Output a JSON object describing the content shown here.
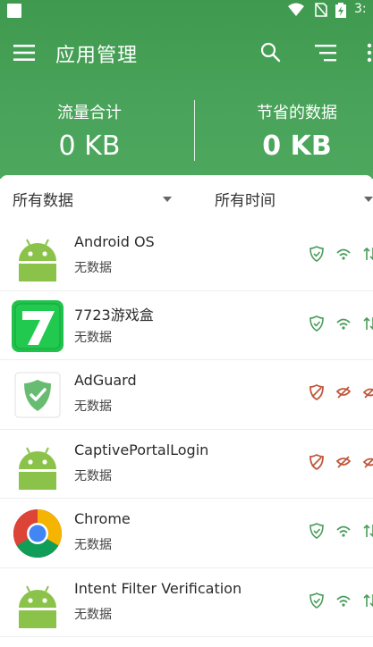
{
  "status_bar": {
    "time": "3:"
  },
  "toolbar": {
    "title": "应用管理"
  },
  "summary": {
    "total_label": "流量合计",
    "total_value": "0 KB",
    "saved_label": "节省的数据",
    "saved_value": "0 KB"
  },
  "filters": {
    "data_filter": "所有数据",
    "time_filter": "所有时间"
  },
  "colors": {
    "header_green": "#46a057",
    "allowed_green": "#4a9d5a",
    "blocked_red": "#c0563a"
  },
  "apps": [
    {
      "name": "Android OS",
      "status": "无数据",
      "icon": "android-icon",
      "state": "allowed"
    },
    {
      "name": "7723游戏盒",
      "status": "无数据",
      "icon": "7723-icon",
      "state": "allowed"
    },
    {
      "name": "AdGuard",
      "status": "无数据",
      "icon": "adguard-icon",
      "state": "blocked"
    },
    {
      "name": "CaptivePortalLogin",
      "status": "无数据",
      "icon": "android-icon",
      "state": "blocked"
    },
    {
      "name": "Chrome",
      "status": "无数据",
      "icon": "chrome-icon",
      "state": "allowed"
    },
    {
      "name": "Intent Filter Verification",
      "status": "无数据",
      "icon": "android-icon",
      "state": "allowed"
    }
  ]
}
